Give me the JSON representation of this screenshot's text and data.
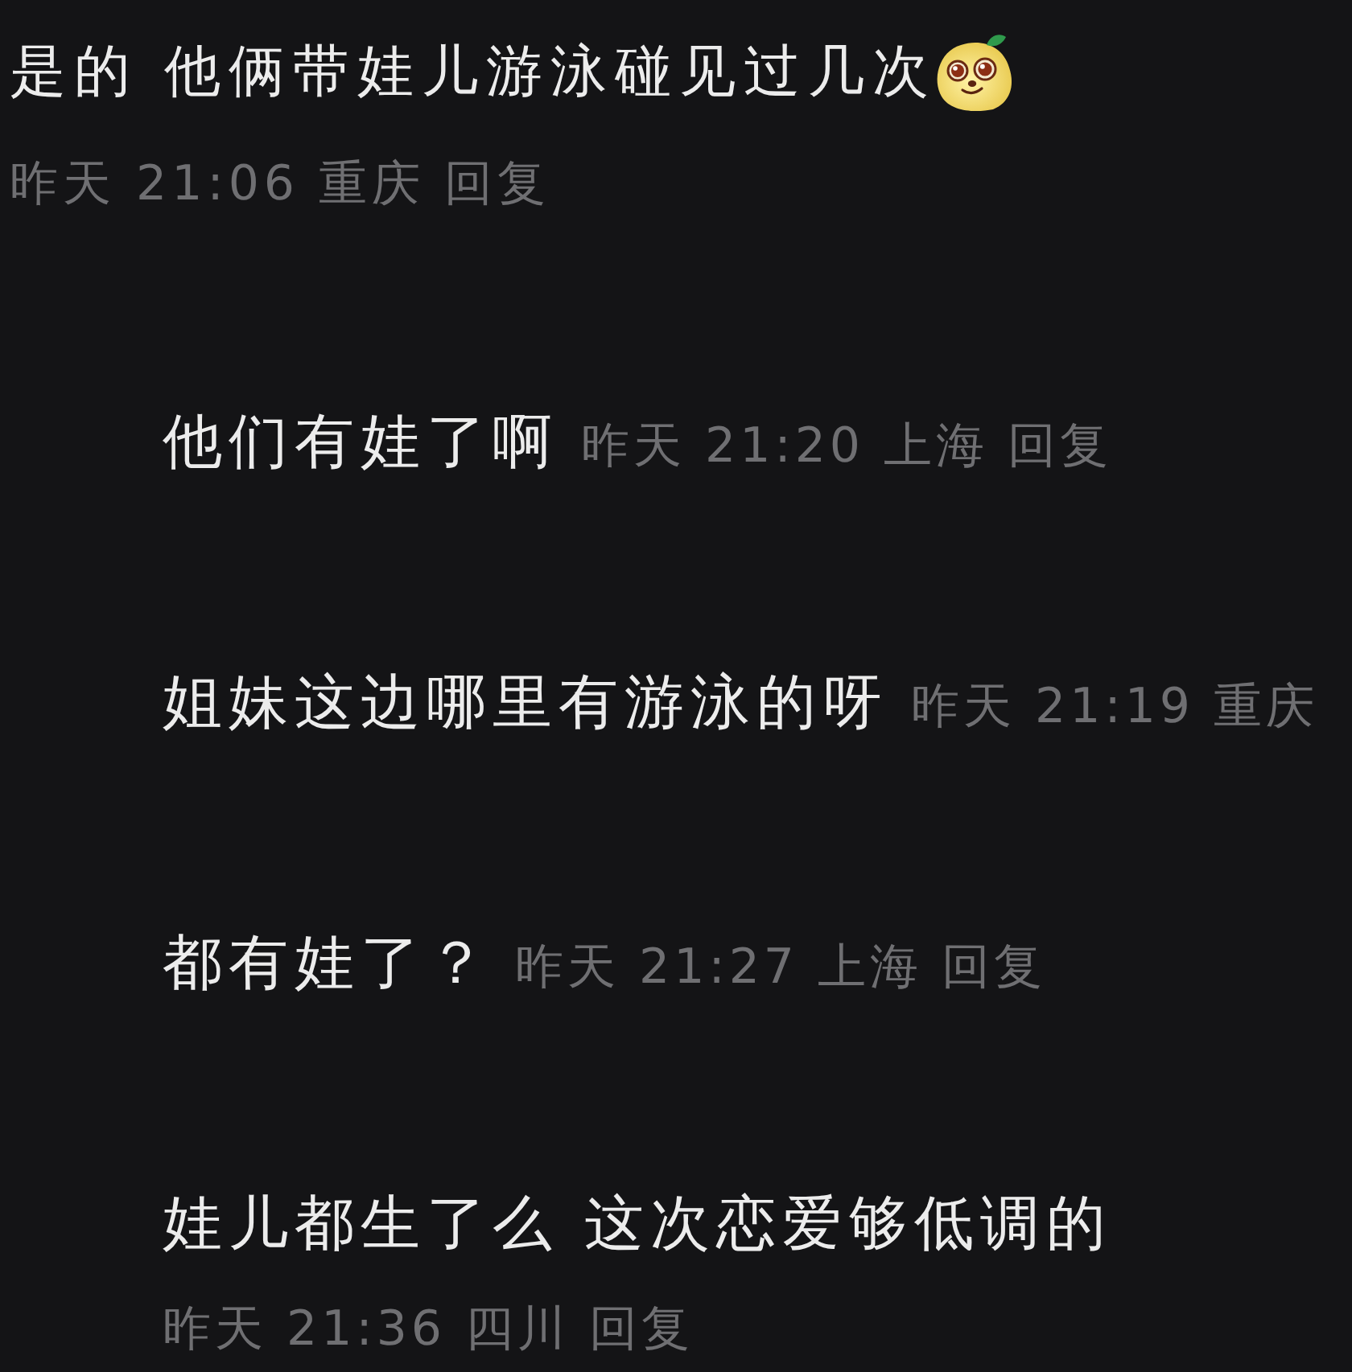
{
  "comment": {
    "text": "是的 他俩带娃儿游泳碰见过几次",
    "time": "昨天 21:06",
    "location": "重庆",
    "reply_label": "回复"
  },
  "replies": [
    {
      "kind": "inline",
      "text": "他们有娃了啊",
      "time": "昨天 21:20",
      "location": "上海",
      "reply_label": "回复"
    },
    {
      "kind": "inline",
      "text": "姐妹这边哪里有游泳的呀",
      "time": "昨天 21:19",
      "location": "重庆"
    },
    {
      "kind": "inline",
      "text": "都有娃了？",
      "time": "昨天 21:27",
      "location": "上海",
      "reply_label": "回复"
    },
    {
      "kind": "stacked",
      "text": "娃儿都生了么 这次恋爱够低调的",
      "time": "昨天 21:36",
      "location": "四川",
      "reply_label": "回复"
    }
  ]
}
